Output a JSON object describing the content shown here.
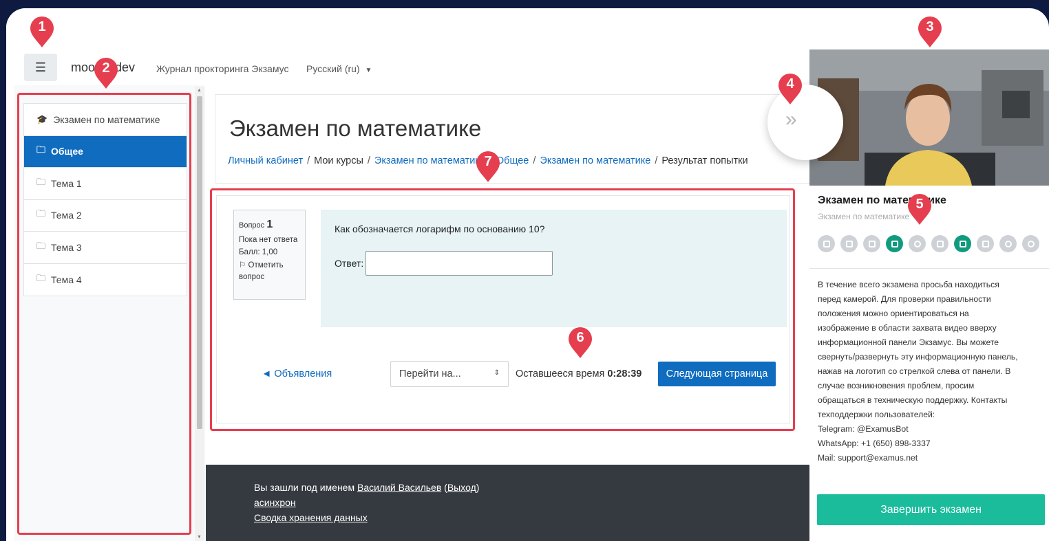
{
  "topbar": {
    "menu_icon": "hamburger-icon",
    "brand": "moodle.dev",
    "proctoring_link": "Журнал прокторинга Экзамус",
    "language": "Русский (ru)"
  },
  "sidebar": {
    "items": [
      {
        "label": "Экзамен по математике",
        "icon": "graduation-cap-icon",
        "active": false
      },
      {
        "label": "Общее",
        "icon": "folder-icon",
        "active": true
      },
      {
        "label": "Тема 1",
        "icon": "folder-icon",
        "active": false
      },
      {
        "label": "Тема 2",
        "icon": "folder-icon",
        "active": false
      },
      {
        "label": "Тема 3",
        "icon": "folder-icon",
        "active": false
      },
      {
        "label": "Тема 4",
        "icon": "folder-icon",
        "active": false
      }
    ]
  },
  "main": {
    "title": "Экзамен по математике",
    "breadcrumbs": [
      "Личный кабинет",
      "Мои курсы",
      "Экзамен по математике",
      "Общее",
      "Экзамен по математике",
      "Результат попытки"
    ],
    "question": {
      "label": "Вопрос",
      "number": "1",
      "status": "Пока нет ответа",
      "score": "Балл: 1,00",
      "flag_label": "Отметить вопрос",
      "text": "Как обозначается логарифм  по основанию 10?",
      "answer_label": "Ответ:",
      "answer_value": ""
    },
    "nav": {
      "announcements": "◄ Объявления",
      "jump_placeholder": "Перейти на...",
      "time_label": "Оставшееся время",
      "time_value": "0:28:39",
      "next_button": "Следующая страница"
    }
  },
  "footer": {
    "logged_prefix": "Вы зашли под именем",
    "user_name": "Василий Васильев",
    "logout": "Выход",
    "line2": "асинхрон",
    "line3": "Сводка хранения данных"
  },
  "proctor_panel": {
    "exam_title": "Экзамен по математике",
    "exam_subtitle": "Экзамен по математике",
    "expand_icon": "double-chevron-right-icon",
    "status_icons": [
      {
        "name": "megaphone-icon",
        "active": false
      },
      {
        "name": "book-icon",
        "active": false
      },
      {
        "name": "calculator-icon",
        "active": false
      },
      {
        "name": "edit-icon",
        "active": true
      },
      {
        "name": "globe-icon",
        "active": false
      },
      {
        "name": "door-icon",
        "active": false
      },
      {
        "name": "grid-icon",
        "active": true
      },
      {
        "name": "screen-icon",
        "active": false
      },
      {
        "name": "eye-off-icon",
        "active": false
      },
      {
        "name": "person-icon",
        "active": false
      }
    ],
    "description": [
      "В течение всего экзамена просьба находиться",
      "перед камерой. Для проверки правильности",
      "положения можно ориентироваться на",
      "изображение в области захвата видео вверху",
      "информационной панели Экзамус. Вы можете",
      "свернуть/развернуть эту информационную панель,",
      "нажав на логотип со стрелкой слева от панели. В",
      "случае возникновения проблем, просим",
      "обращаться в техническую поддержку. Контакты",
      "техподдержки пользователей:",
      "Telegram: @ExamusBot",
      "WhatsApp: +1 (650) 898-3337",
      "Mail: support@examus.net"
    ],
    "finish_button": "Завершить экзамен"
  },
  "annotations": [
    "1",
    "2",
    "3",
    "4",
    "5",
    "6",
    "7"
  ],
  "colors": {
    "background": "#0f1a40",
    "primary": "#0f6cbf",
    "accent": "#1abc9c",
    "annotation": "#e53e4f",
    "footer": "#343a40"
  }
}
